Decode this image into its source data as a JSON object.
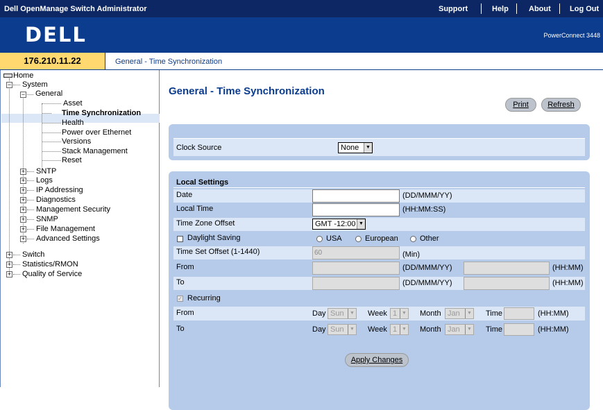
{
  "app": {
    "title": "Dell OpenManage Switch Administrator",
    "links": [
      "Support",
      "Help",
      "About",
      "Log Out"
    ],
    "logo": "DELL",
    "product": "PowerConnect 3448"
  },
  "ip_address": "176.210.11.22",
  "breadcrumb": "General - Time Synchronization",
  "tree": {
    "home": "Home",
    "system": "System",
    "general": "General",
    "asset": "Asset",
    "time_sync": "Time Synchronization",
    "health": "Health",
    "poe": "Power over Ethernet",
    "versions": "Versions",
    "stack_mgmt": "Stack Management",
    "reset": "Reset",
    "sntp": "SNTP",
    "logs": "Logs",
    "ip_addressing": "IP Addressing",
    "diagnostics": "Diagnostics",
    "mgmt_security": "Management Security",
    "snmp": "SNMP",
    "file_mgmt": "File Management",
    "advanced": "Advanced Settings",
    "switch": "Switch",
    "stats": "Statistics/RMON",
    "qos": "Quality of Service"
  },
  "page": {
    "title": "General - Time Synchronization",
    "print": "Print",
    "refresh": "Refresh",
    "apply": "Apply Changes"
  },
  "clock": {
    "label": "Clock Source",
    "value": "None"
  },
  "local": {
    "header": "Local Settings",
    "date_label": "Date",
    "date_value": "",
    "date_hint": "(DD/MMM/YY)",
    "time_label": "Local Time",
    "time_value": "",
    "time_hint": "(HH:MM:SS)",
    "tz_label": "Time Zone Offset",
    "tz_value": "GMT -12:00",
    "dst_label": "Daylight Saving",
    "dst_checked": false,
    "dst_options": [
      "USA",
      "European",
      "Other"
    ],
    "offset_label": "Time Set Offset (1-1440)",
    "offset_value": "60",
    "offset_hint": "(Min)",
    "from_label": "From",
    "to_label": "To",
    "date_fmt": "(DD/MMM/YY)",
    "time_fmt": "(HH:MM)",
    "recurring_label": "Recurring",
    "recurring_checked": true,
    "rec_day": "Day",
    "rec_week": "Week",
    "rec_month": "Month",
    "rec_time": "Time",
    "from_day": "Sun",
    "from_week": "1",
    "from_month": "Jan",
    "to_day": "Sun",
    "to_week": "1",
    "to_month": "Jan"
  }
}
